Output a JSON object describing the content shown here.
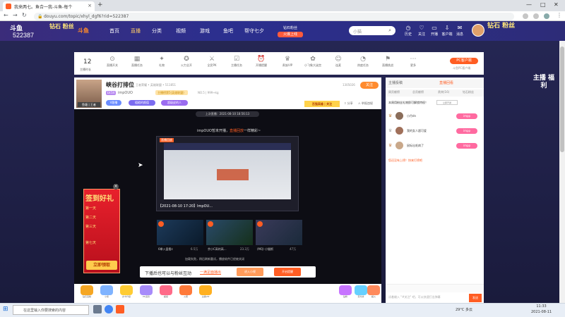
{
  "browser": {
    "tab_title": "我来两七。鱼合一我-斗鱼-每个",
    "url": "douyu.com/topic/xhyl_dgf6?rid=522387",
    "new_tab": "+",
    "window_controls": [
      "—",
      "□",
      "✕"
    ]
  },
  "site": {
    "logo": "斗鱼",
    "room_number": "522387",
    "promo_left": "钻石 粉丝",
    "promo_logo": "斗鱼",
    "nav": [
      "首页",
      "直播",
      "分类",
      "视频",
      "游戏",
      "鱼吧",
      "帮守七夕"
    ],
    "nav_badge_top": "钻石粉丝",
    "nav_badge_bottom": "火爆上线",
    "search_placeholder": "小猫",
    "header_icons": [
      "历史",
      "关注",
      "开播",
      "客户端",
      "消息"
    ],
    "promo_right": "钻石 粉丝"
  },
  "toolbar": {
    "level_num": "12",
    "level_label": "主播时长",
    "items": [
      "直播开关",
      "直播任务",
      "礼物",
      "火力全开",
      "全民PK",
      "主播任务",
      "开播提醒",
      "贵族VIP",
      "小飞象大迷宫",
      "连麦",
      "热度任务",
      "直播挑战",
      "更多"
    ],
    "pc_button": "PC客户端",
    "pc_sub": "斗鱼PC客户端"
  },
  "stream": {
    "title": "峡谷打排位",
    "category": "王者荣耀 • 英雄联盟 • 511851",
    "level": "LV.54",
    "streamer": "impOUO",
    "rank_tag": "主播榜第5(英雄联盟)",
    "extra": "NO.5 | 999+kg",
    "tags": [
      "V跟播",
      "粗糙的颜值",
      "超级皮的人"
    ],
    "rank_right": "1305026",
    "follow": "关注",
    "live_badge": "百强英雄 | 关注",
    "actions": [
      "分享",
      "举报违规"
    ],
    "avatar_badge": "鱼塘 | 王者"
  },
  "player": {
    "last_live": "上次直播：2021-08-10 18:56:13",
    "offline_prefix": "impOUO暂未开播，",
    "offline_link": "直播回放",
    "offline_suffix": "一样精彩~",
    "replay_top": "直播回放",
    "replay_caption": "【2021-08-10 17:20】ImpOU...",
    "recs": [
      {
        "title": "6拳入盘看z",
        "count": "6.5万"
      },
      {
        "title": "余小C高的高...",
        "count": "23.3万"
      },
      {
        "title": "(MQ) 小猫斯",
        "count": "47万"
      }
    ],
    "fail_msg": "加载失败，稍后刷新重试，播放软件已经被关闭",
    "dl_text": "下播后也可以与粉丝互动",
    "dl_link": "一满足面播出",
    "dl_btn1": "进入小视",
    "dl_btn2": "开启提醒"
  },
  "gifts": [
    "钻石宝箱",
    "小熊",
    "办卡升级",
    "PK道具",
    "超级",
    "火箭",
    "主播VIP",
    "钻粉",
    "荧光棒",
    "超火"
  ],
  "right_panel": {
    "tab1": "主播投稿",
    "tab2": "直播回看",
    "subtabs": [
      "周贡献榜",
      "总贡献榜",
      "贵宾(16)",
      "钻石粉丝"
    ],
    "note": "本周用粉丝礼物即可解锁特权！",
    "note_btn": "立即开通",
    "ranks": [
      {
        "name": "小丹dn",
        "badge": "impp"
      },
      {
        "name": "我的女人超可爱",
        "badge": "impp"
      },
      {
        "name": "鼠标出毛病了",
        "badge": "impp"
      }
    ],
    "link": "您还没有上榜！快来打榜吧",
    "chat_placeholder": "试着输入 \"#关注\" 吧，可以快速打出弹幕",
    "chat_send": "发送"
  },
  "checkin": {
    "title": "签到好礼",
    "days": [
      "第一天",
      "第二天",
      "第三天",
      "第七天"
    ],
    "button": "立即领取"
  },
  "float_right": "主播 福利",
  "taskbar": {
    "search": "在这里输入你要搜索的内容",
    "weather": "29°C 多云",
    "time": "11:33",
    "date": "2021-08-11"
  }
}
